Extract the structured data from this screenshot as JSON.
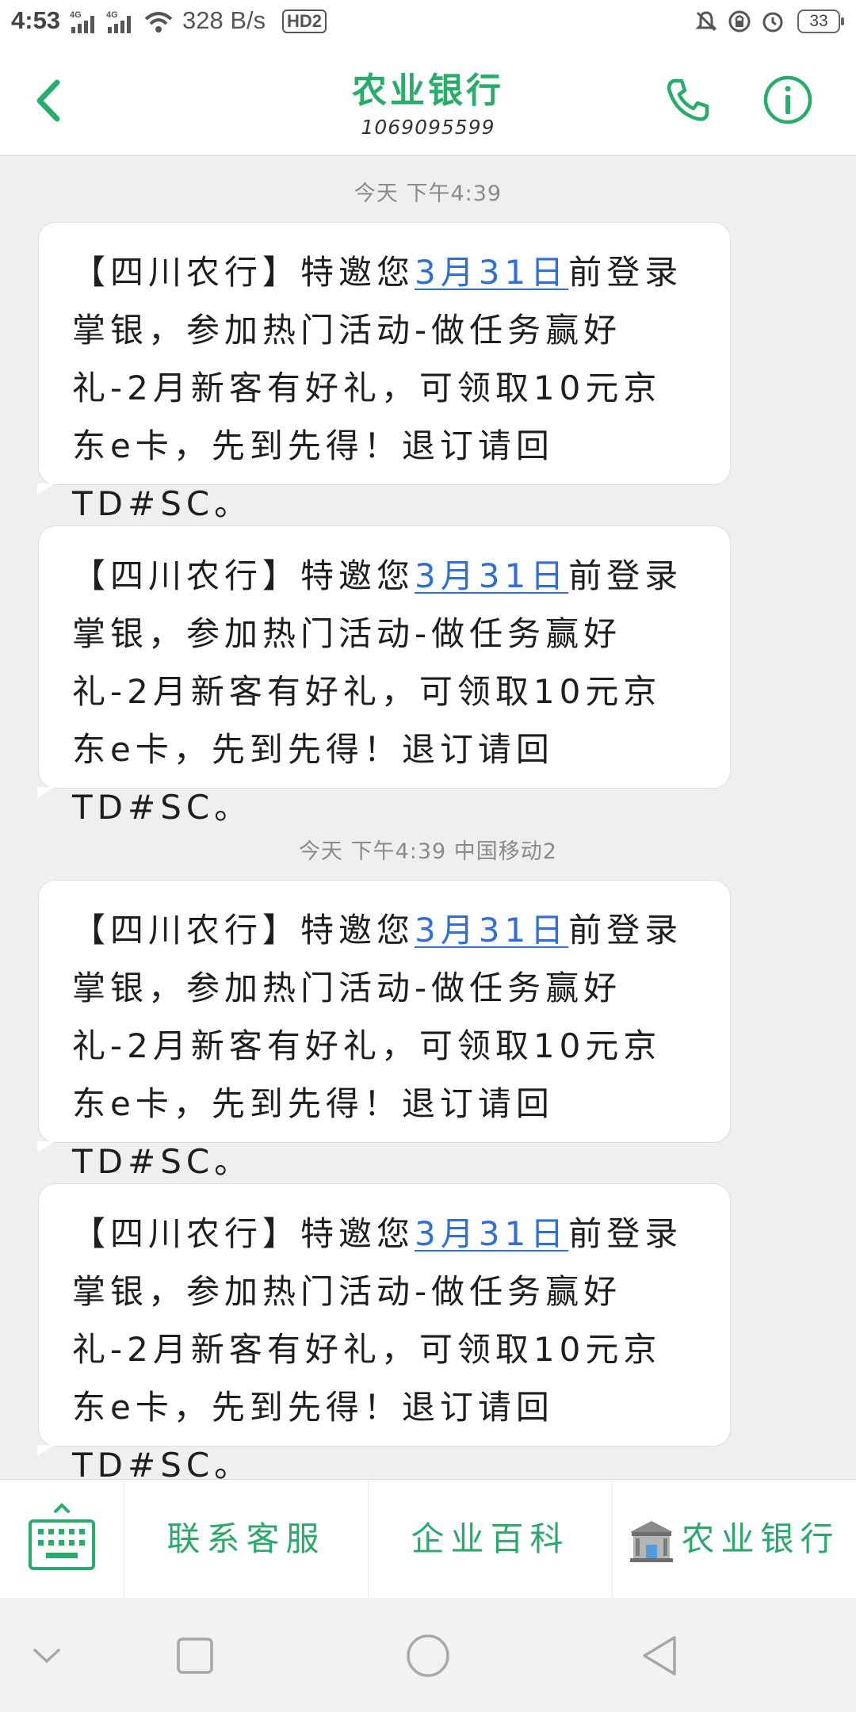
{
  "status_bar": {
    "time": "4:53",
    "network_1": "4G",
    "network_2": "4G",
    "speed": "328 B/s",
    "hd": "HD2",
    "battery": "33"
  },
  "header": {
    "title": "农业银行",
    "number": "1069095599"
  },
  "messages": {
    "timestamp_1": "今天 下午4:39",
    "timestamp_2": "今天 下午4:39  中国移动2",
    "pre": "【四川农行】特邀您",
    "date": "3月31日",
    "post": "前登录掌银，参加热门活动-做任务赢好礼-2月新客有好礼，可领取10元京东e卡，先到先得！退订请回TD#SC。"
  },
  "menu": {
    "contact": "联系客服",
    "encyclopedia": "企业百科",
    "bank": "农业银行"
  },
  "colors": {
    "accent": "#27ad6a",
    "link": "#2f6fd6"
  }
}
